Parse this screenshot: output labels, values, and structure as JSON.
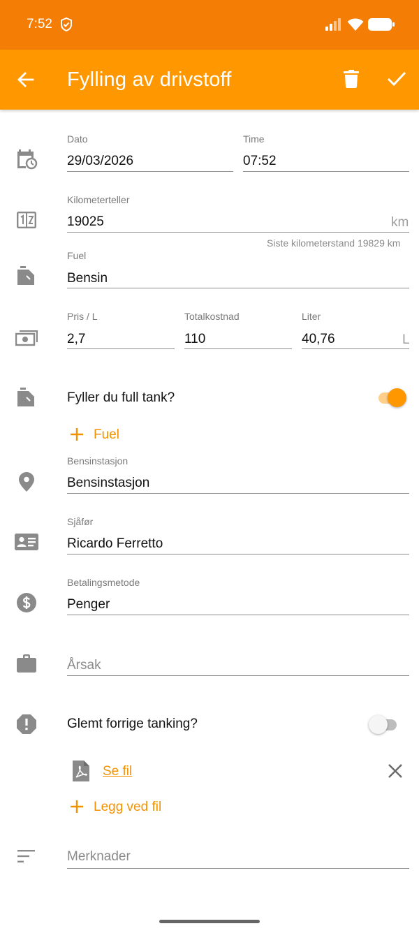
{
  "status_bar": {
    "time": "7:52"
  },
  "app_bar": {
    "title": "Fylling av drivstoff"
  },
  "date_time": {
    "date_label": "Dato",
    "date_value": "29/03/2026",
    "time_label": "Time",
    "time_value": "07:52"
  },
  "odometer": {
    "label": "Kilometerteller",
    "value": "19025",
    "unit": "km",
    "hint": "Siste kilometerstand 19829 km"
  },
  "fuel": {
    "label": "Fuel",
    "value": "Bensin"
  },
  "price": {
    "price_label": "Pris / L",
    "price_value": "2,7",
    "total_label": "Totalkostnad",
    "total_value": "110",
    "liter_label": "Liter",
    "liter_value": "40,76",
    "liter_unit": "L"
  },
  "full_tank": {
    "question": "Fyller du full tank?",
    "enabled": true
  },
  "add_fuel": {
    "label": "Fuel"
  },
  "station": {
    "label": "Bensinstasjon",
    "value": "Bensinstasjon"
  },
  "driver": {
    "label": "Sjåfør",
    "value": "Ricardo Ferretto"
  },
  "payment": {
    "label": "Betalingsmetode",
    "value": "Penger"
  },
  "reason": {
    "placeholder": "Årsak"
  },
  "forgot": {
    "question": "Glemt forrige tanking?",
    "enabled": false
  },
  "attachment": {
    "link": "Se fil"
  },
  "add_file": {
    "label": "Legg ved fil"
  },
  "notes": {
    "placeholder": "Merknader"
  },
  "colors": {
    "accent": "#ff9800",
    "status_bar": "#f47d06",
    "icon_gray": "#8a8a8a"
  },
  "icons": [
    "calendar-clock-icon",
    "odometer-icon",
    "fuel-can-icon",
    "money-icon",
    "location-pin-icon",
    "driver-card-icon",
    "dollar-icon",
    "briefcase-icon",
    "alert-octagon-icon",
    "pdf-file-icon",
    "notes-icon"
  ]
}
